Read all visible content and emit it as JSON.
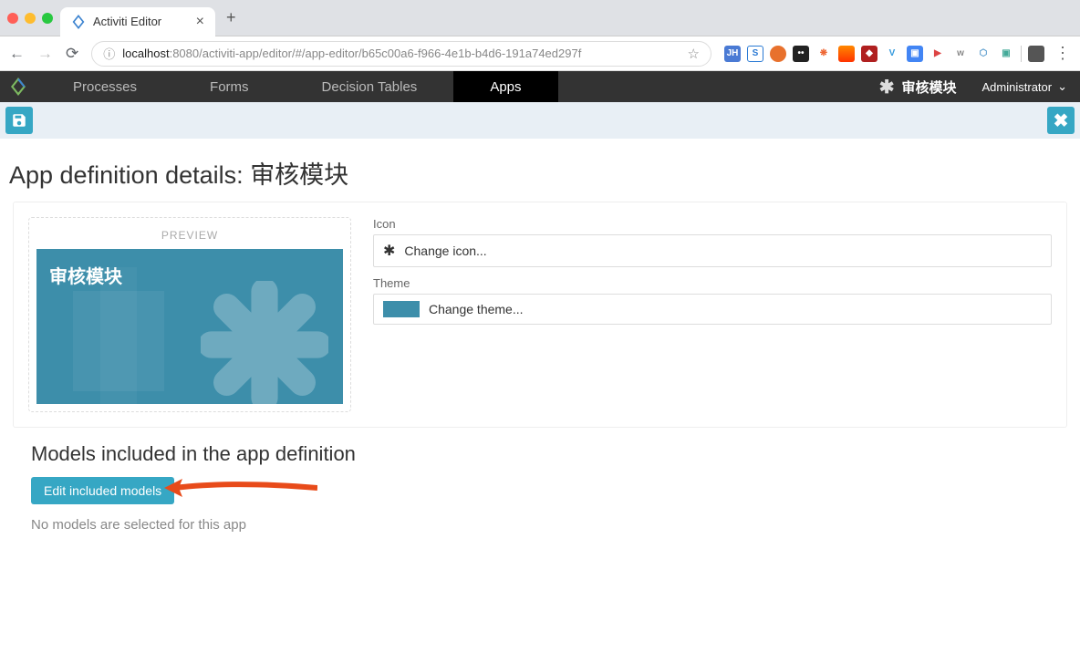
{
  "browser": {
    "tab_title": "Activiti Editor",
    "url_host": "localhost",
    "url_port": ":8080",
    "url_path": "/activiti-app/editor/#/app-editor/b65c00a6-f966-4e1b-b4d6-191a74ed297f"
  },
  "nav": {
    "processes": "Processes",
    "forms": "Forms",
    "decision_tables": "Decision Tables",
    "apps": "Apps",
    "app_name": "审核模块",
    "admin": "Administrator"
  },
  "page": {
    "title_prefix": "App definition details: ",
    "title_name": "审核模块",
    "preview_label": "PREVIEW",
    "tile_title": "审核模块",
    "icon_label": "Icon",
    "change_icon": "Change icon...",
    "theme_label": "Theme",
    "change_theme": "Change theme...",
    "models_title": "Models included in the app definition",
    "edit_models_btn": "Edit included models",
    "no_models": "No models are selected for this app"
  }
}
